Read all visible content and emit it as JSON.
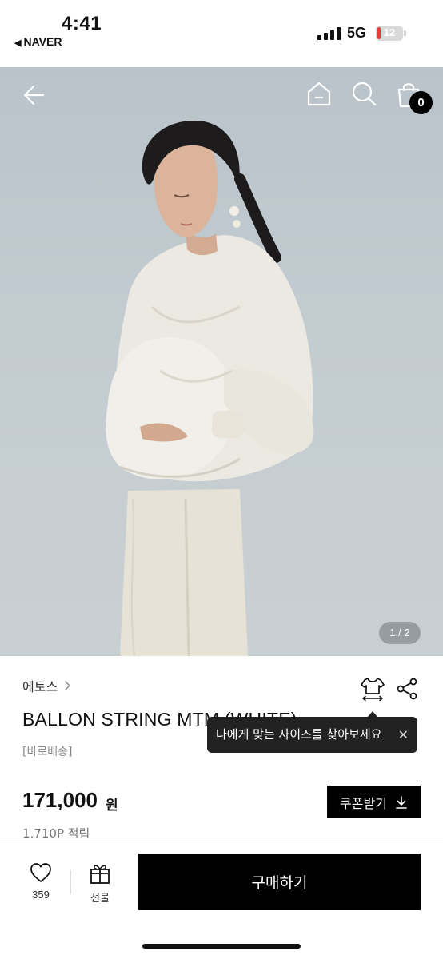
{
  "status_bar": {
    "time": "4:41",
    "back_app": "NAVER",
    "network": "5G",
    "battery": "12",
    "battery_level": 0.12
  },
  "nav": {
    "cart_count": "0"
  },
  "gallery": {
    "pager": "1 / 2"
  },
  "product": {
    "brand": "에토스",
    "title": "BALLON STRING MTM (WHITE)",
    "delivery_tag": "[바로배송]",
    "price": "171,000",
    "currency": "원",
    "points": "1,710P 적립"
  },
  "size_tooltip": {
    "text": "나에게 맞는 사이즈를 찾아보세요",
    "close": "✕"
  },
  "coupon": {
    "label": "쿠폰받기"
  },
  "bottom_bar": {
    "like_count": "359",
    "gift_label": "선물",
    "buy_label": "구매하기"
  },
  "icons": [
    "back-arrow-icon",
    "home-icon",
    "search-icon",
    "shopping-bag-icon",
    "chevron-right-icon",
    "size-guide-shirt-icon",
    "share-icon",
    "download-icon",
    "heart-icon",
    "gift-icon",
    "close-icon"
  ],
  "colors": {
    "accent": "#000000",
    "tooltip_bg": "#222222",
    "battery_low": "#ea3a3a"
  }
}
